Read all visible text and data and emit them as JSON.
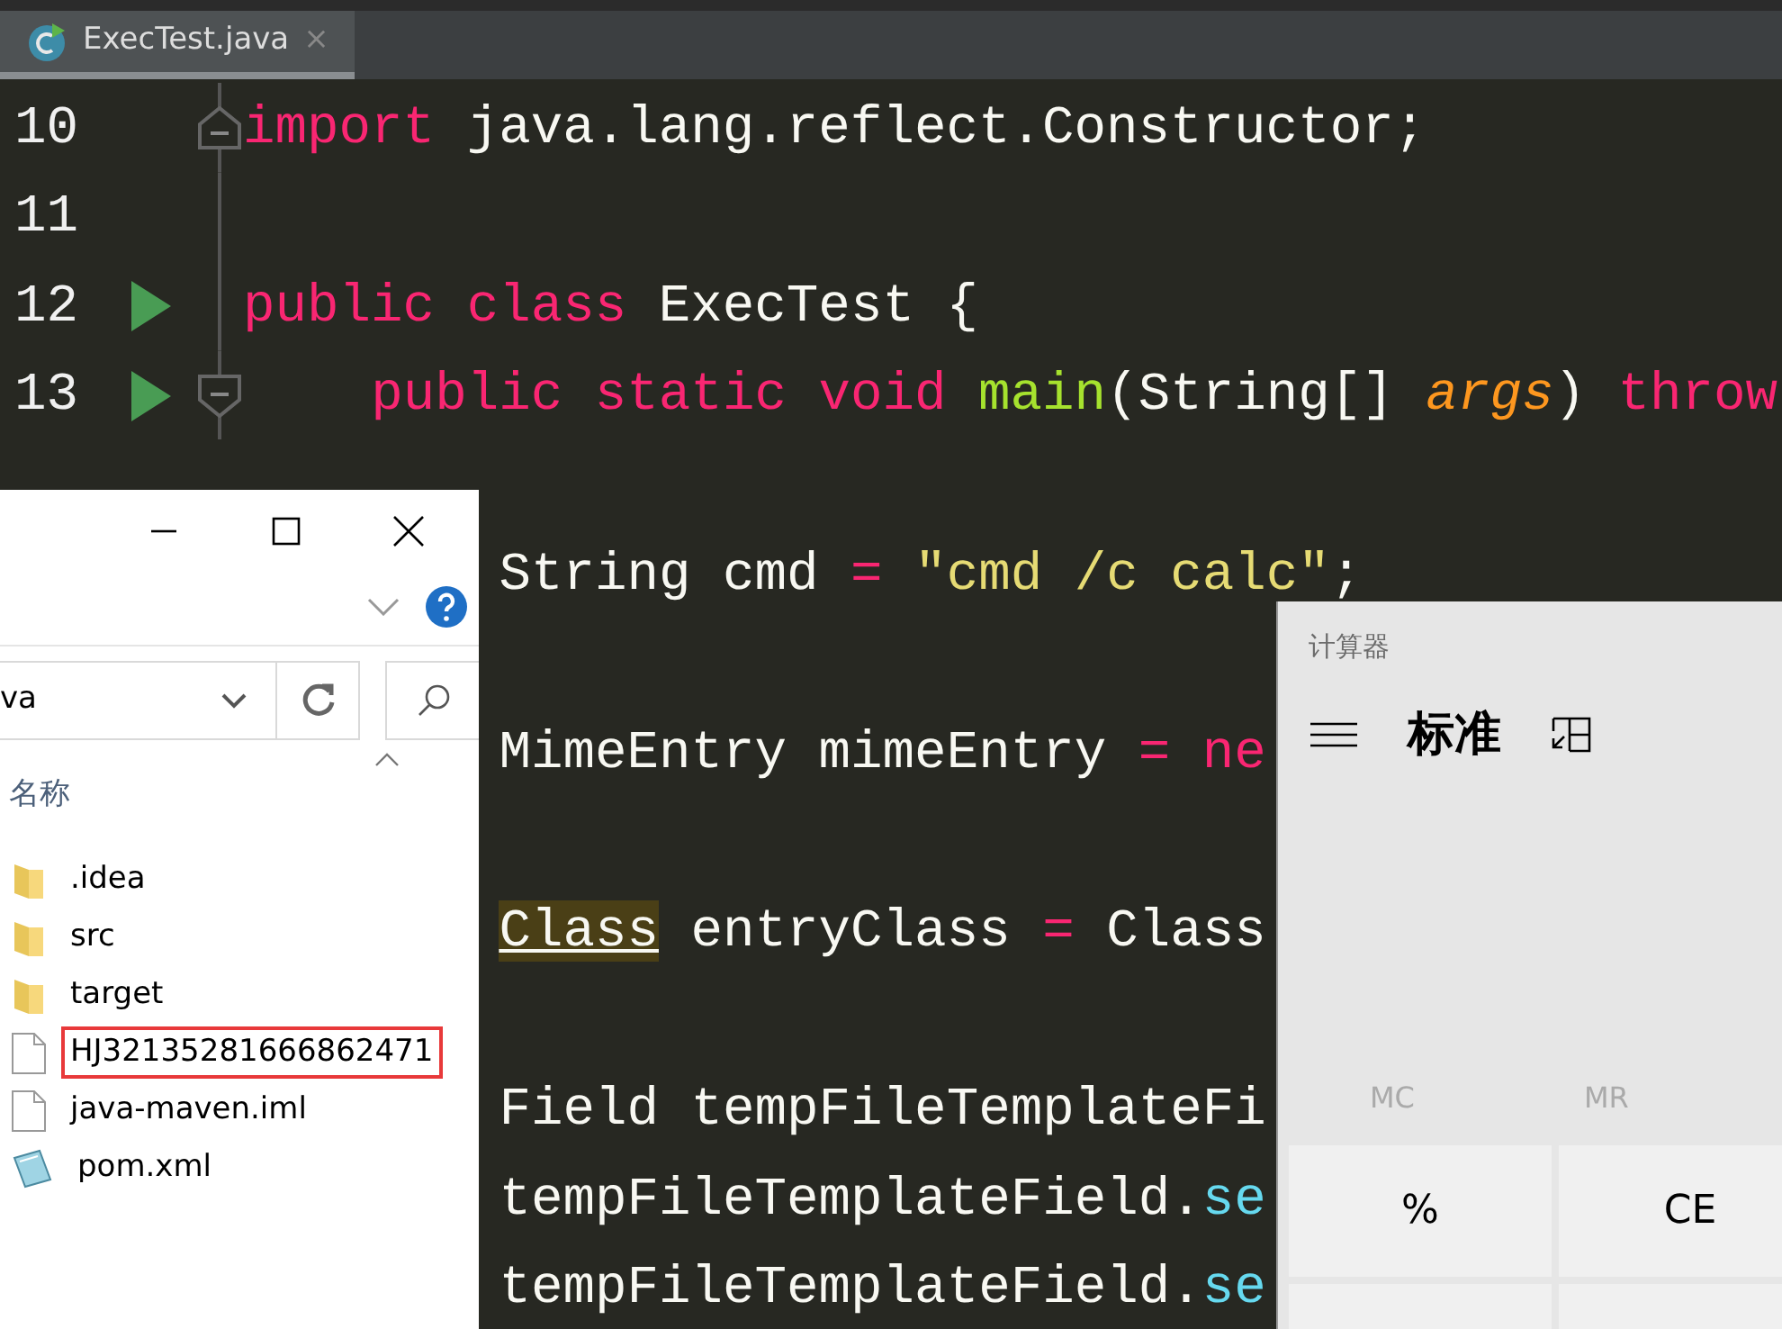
{
  "editor": {
    "tab": {
      "title": "ExecTest.java",
      "close": "×",
      "selected": true
    },
    "lines": [
      {
        "kind": "code",
        "number": "10",
        "fold_end": true,
        "tokens": [
          {
            "kind": "keyword",
            "text": "import"
          },
          {
            "kind": "plain",
            "text": " java.lang.reflect.Constructor;"
          }
        ]
      },
      {
        "kind": "blank",
        "number": "11"
      },
      {
        "kind": "code",
        "number": "12",
        "run": true,
        "tokens": [
          {
            "kind": "keyword",
            "text": "public class"
          },
          {
            "kind": "plain",
            "text": " ExecTest {"
          }
        ],
        "children": [
          {
            "kind": "code",
            "number": "13",
            "run": true,
            "fold_start": true,
            "tokens": [
              {
                "kind": "keyword",
                "text": "public static void "
              },
              {
                "kind": "method",
                "text": "main"
              },
              {
                "kind": "plain",
                "text": "(String[] "
              },
              {
                "kind": "param",
                "text": "args"
              },
              {
                "kind": "plain",
                "text": ") "
              },
              {
                "kind": "keyword",
                "text": "throw"
              }
            ],
            "children": [
              {
                "kind": "blank"
              },
              {
                "kind": "code",
                "tokens": [
                  {
                    "kind": "plain",
                    "text": "String cmd "
                  },
                  {
                    "kind": "operator",
                    "text": "="
                  },
                  {
                    "kind": "string",
                    "text": " \"cmd /c calc\""
                  },
                  {
                    "kind": "plain",
                    "text": ";"
                  }
                ]
              },
              {
                "kind": "blank"
              },
              {
                "kind": "code",
                "tokens": [
                  {
                    "kind": "plain",
                    "text": "MimeEntry mimeEntry "
                  },
                  {
                    "kind": "operator",
                    "text": "="
                  },
                  {
                    "kind": "keyword",
                    "text": " ne"
                  }
                ]
              },
              {
                "kind": "blank"
              },
              {
                "kind": "code",
                "tokens": [
                  {
                    "kind": "plain",
                    "text": "Class",
                    "highlighted": true
                  },
                  {
                    "kind": "plain",
                    "text": " entryClass "
                  },
                  {
                    "kind": "operator",
                    "text": "="
                  },
                  {
                    "kind": "plain",
                    "text": " Class"
                  }
                ]
              },
              {
                "kind": "blank"
              },
              {
                "kind": "code",
                "tokens": [
                  {
                    "kind": "plain",
                    "text": "Field tempFileTemplateFi"
                  }
                ]
              },
              {
                "kind": "code",
                "tokens": [
                  {
                    "kind": "plain",
                    "text": "tempFileTemplateField."
                  },
                  {
                    "kind": "call",
                    "text": "se"
                  }
                ]
              },
              {
                "kind": "code",
                "tokens": [
                  {
                    "kind": "plain",
                    "text": "tempFileTemplateField."
                  },
                  {
                    "kind": "call",
                    "text": "se"
                  }
                ]
              }
            ]
          }
        ]
      }
    ]
  },
  "explorer": {
    "address": "va",
    "column": "名称",
    "files": [
      {
        "name": ".idea",
        "kind": "folder",
        "annotated": false
      },
      {
        "name": "src",
        "kind": "folder",
        "annotated": false
      },
      {
        "name": "target",
        "kind": "folder",
        "annotated": false
      },
      {
        "name": "HJ32135281666862471",
        "kind": "file",
        "annotated": true
      },
      {
        "name": "java-maven.iml",
        "kind": "file",
        "annotated": false
      },
      {
        "name": "pom.xml",
        "kind": "xml",
        "annotated": false
      }
    ]
  },
  "calculator": {
    "title": "计算器",
    "mode": "标准",
    "memory": [
      {
        "label": "MC",
        "disabled": true
      },
      {
        "label": "MR",
        "disabled": true
      }
    ],
    "keys": [
      "%",
      "CE"
    ]
  }
}
